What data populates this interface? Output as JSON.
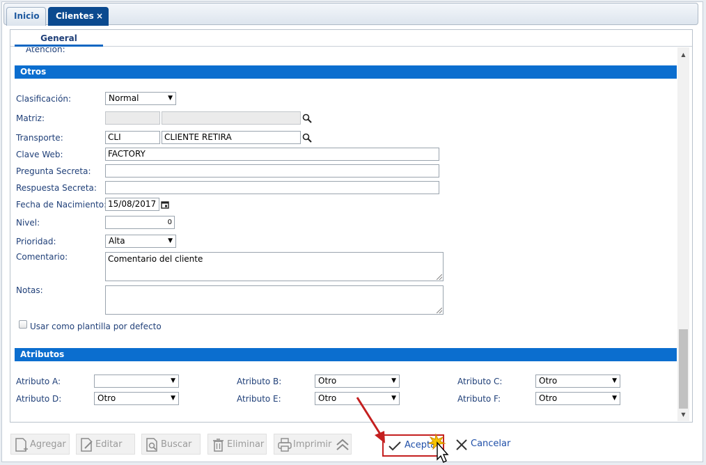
{
  "tabs": {
    "inicio": "Inicio",
    "clientes": "Clientes",
    "close_glyph": "×"
  },
  "subtab": "General",
  "clipped_label": "Atención:",
  "otros": {
    "header": "Otros",
    "clasificacion_label": "Clasificación:",
    "clasificacion_value": "Normal",
    "matriz_label": "Matriz:",
    "transporte_label": "Transporte:",
    "transporte_code": "CLI",
    "transporte_name": "CLIENTE RETIRA",
    "clave_web_label": "Clave Web:",
    "clave_web_value": "FACTORY",
    "pregunta_label": "Pregunta Secreta:",
    "respuesta_label": "Respuesta Secreta:",
    "fecha_label": "Fecha de Nacimiento:",
    "fecha_value": "15/08/2017",
    "nivel_label": "Nivel:",
    "nivel_value": "0",
    "prioridad_label": "Prioridad:",
    "prioridad_value": "Alta",
    "comentario_label": "Comentario:",
    "comentario_value": "Comentario del cliente",
    "notas_label": "Notas:",
    "plantilla_label": "Usar como plantilla por defecto"
  },
  "atributos": {
    "header": "Atributos",
    "a_label": "Atributo A:",
    "a_value": "",
    "b_label": "Atributo B:",
    "b_value": "Otro",
    "c_label": "Atributo C:",
    "c_value": "Otro",
    "d_label": "Atributo D:",
    "d_value": "Otro",
    "e_label": "Atributo E:",
    "e_value": "Otro",
    "f_label": "Atributo F:",
    "f_value": "Otro"
  },
  "toolbar": {
    "agregar": "Agregar",
    "editar": "Editar",
    "buscar": "Buscar",
    "eliminar": "Eliminar",
    "imprimir": "Imprimir",
    "aceptar": "Aceptar",
    "cancelar": "Cancelar"
  },
  "colors": {
    "accent": "#0b6ecf",
    "tab_active": "#0b4a8f",
    "highlight_border": "#c41f1f"
  }
}
